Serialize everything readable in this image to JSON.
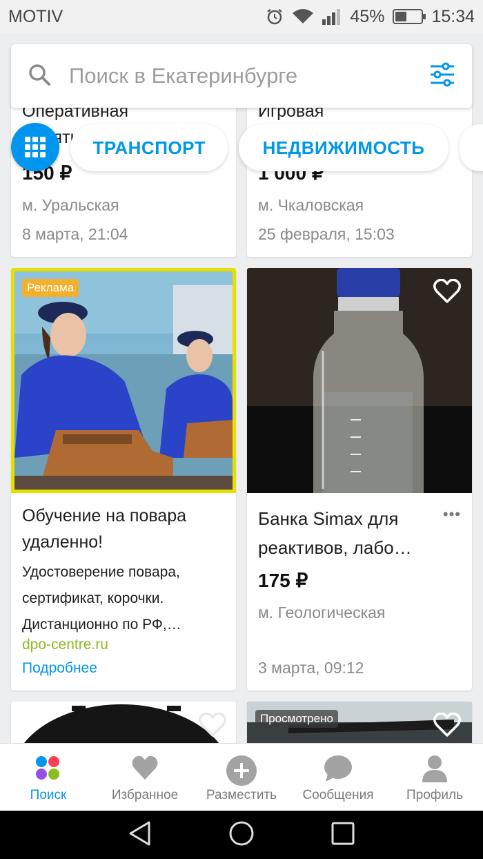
{
  "status_bar": {
    "carrier": "MOTIV",
    "battery": "45%",
    "battery_level": 0.45,
    "time": "15:34"
  },
  "search": {
    "placeholder": "Поиск в Екатеринбурге"
  },
  "chips": {
    "transport": "ТРАНСПОРТ",
    "realty": "НЕДВИЖИМОСТЬ"
  },
  "listings": [
    {
      "title_top": "Оперативная",
      "title_partial": "память",
      "price": "150 ₽",
      "location": "м. Уральская",
      "date": "8 марта, 21:04"
    },
    {
      "title_top": "Игровая",
      "price": "1 000 ₽",
      "location": "м. Чкаловская",
      "date": "25 февраля, 15:03"
    },
    {
      "badge": "Реклама",
      "title": "Обучение на повара удаленно!",
      "description": "Удостоверение повара, сертификат, корочки. Дистанционно по РФ,…",
      "domain": "dpo-centre.ru",
      "more": "Подробнее"
    },
    {
      "title": "Банка Simax для реактивов, лабо…",
      "price": "175 ₽",
      "location": "м. Геологическая",
      "date": "3 марта, 09:12"
    },
    {
      "badge": "Просмотрено"
    }
  ],
  "bottom_nav": [
    {
      "label": "Поиск",
      "icon": "search-dots-icon",
      "active": true
    },
    {
      "label": "Избранное",
      "icon": "heart-icon"
    },
    {
      "label": "Разместить",
      "icon": "plus-circle-icon"
    },
    {
      "label": "Сообщения",
      "icon": "chat-bubble-icon"
    },
    {
      "label": "Профиль",
      "icon": "person-icon"
    }
  ],
  "colors": {
    "accent": "#0096f0",
    "ad_border": "#e6e000",
    "ad_badge": "#f2b02c",
    "domain_green": "#8cbd1e"
  }
}
